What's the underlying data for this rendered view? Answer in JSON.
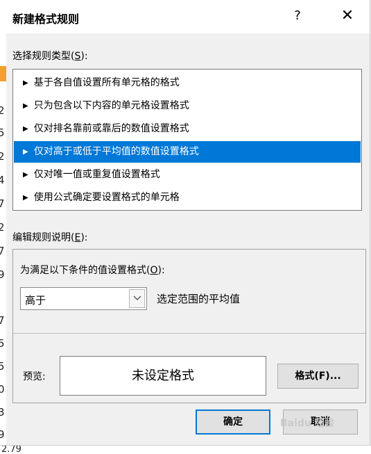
{
  "background": {
    "row_fragments": [
      "2",
      "5",
      "2",
      "4",
      "7",
      "2",
      "7",
      "9",
      "7",
      "5",
      "5",
      "0",
      "3",
      "9"
    ],
    "bottom_fragment": "2.79"
  },
  "dialog": {
    "title": "新建格式规则",
    "help_label": "?",
    "close_label": "✕"
  },
  "rule_type": {
    "label_prefix": "选择规则类型(",
    "label_key": "S",
    "label_suffix": "):",
    "items": [
      {
        "label": "基于各自值设置所有单元格的格式"
      },
      {
        "label": "只为包含以下内容的单元格设置格式"
      },
      {
        "label": "仅对排名靠前或靠后的数值设置格式"
      },
      {
        "label": "仅对高于或低于平均值的数值设置格式",
        "selected": true
      },
      {
        "label": "仅对唯一值或重复值设置格式"
      },
      {
        "label": "使用公式确定要设置格式的单元格"
      }
    ]
  },
  "description": {
    "label_prefix": "编辑规则说明(",
    "label_key": "E",
    "label_suffix": "):",
    "condition_prefix": "为满足以下条件的值设置格式(",
    "condition_key": "O",
    "condition_suffix": "):",
    "combo_value": "高于",
    "combo_suffix": "选定范围的平均值",
    "preview_label": "预览:",
    "preview_text": "未设定格式",
    "format_button": "格式(F)..."
  },
  "footer": {
    "ok_label": "确定",
    "cancel_label": "取消",
    "watermark": "Baidu 经验"
  },
  "colors": {
    "selected": "#0078d7",
    "dialog_bg": "#f0f0f0"
  }
}
